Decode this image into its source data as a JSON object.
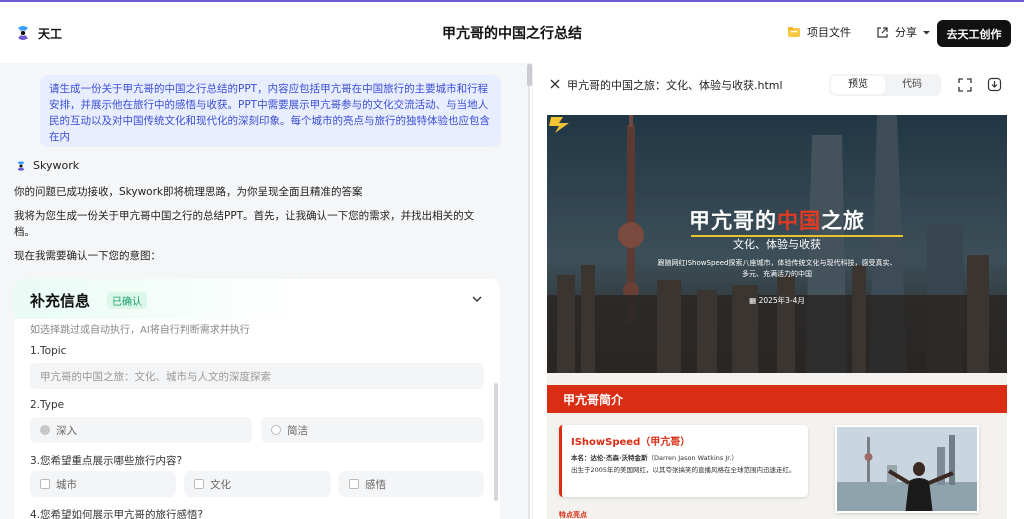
{
  "app": {
    "brand_name": "天工",
    "page_title": "甲亢哥的中国之行总结",
    "files_label": "项目文件",
    "share_label": "分享",
    "create_label": "去天工创作",
    "accent_color": "#3b4fd6"
  },
  "chat": {
    "user_prompt": "请生成一份关于甲亢哥的中国之行总结的PPT，内容应包括甲亢哥在中国旅行的主要城市和行程安排，并展示他在旅行中的感悟与收获。PPT中需要展示甲亢哥参与的文化交流活动、与当地人民的互动以及对中国传统文化和现代化的深刻印象。每个城市的亮点与旅行的独特体验也应包含在内",
    "agent_name": "Skywork",
    "reply_1": "你的问题已成功接收，Skywork即将梳理思路，为你呈现全面且精准的答案",
    "reply_2": "我将为您生成一份关于甲亢哥中国之行的总结PPT。首先，让我确认一下您的需求，并找出相关的文档。",
    "reply_3": "现在我需要确认一下您的意图：",
    "form": {
      "title": "补充信息",
      "badge": "已确认",
      "hint": "如选择跳过或自动执行，AI将自行判断需求并执行",
      "q1": "1.Topic",
      "topic_value": "甲亢哥的中国之旅：文化、城市与人文的深度探索",
      "q2": "2.Type",
      "type_options": [
        "深入",
        "简洁"
      ],
      "q3": "3.您希望重点展示哪些旅行内容?",
      "content_options": [
        "城市",
        "文化",
        "感悟"
      ],
      "q4": "4.您希望如何展示甲亢哥的旅行感悟?"
    }
  },
  "preview": {
    "file_name": "甲亢哥的中国之旅：文化、体验与收获.html",
    "tab_preview": "预览",
    "tab_code": "代码",
    "slide": {
      "title_part1": "甲亢哥的",
      "title_part2": "中国",
      "title_part3": "之旅",
      "subtitle": "文化、体验与收获",
      "desc": "跟随网红IShowSpeed探索八座城市，体验传统文化与现代科技，感受真实、多元、充满活力的中国",
      "date": "2025年3-4月",
      "section_title": "甲亢哥简介",
      "name": "IShowSpeed（甲亢哥）",
      "real_name_label": "本名：",
      "real_name": "达伦·杰森·沃特金斯",
      "real_name_en": "（Darren Jason Watkins Jr.）",
      "bio": "出生于2005年的美国网红，以其夸张搞笑的直播风格在全球范围内迅速走红。",
      "feature_label": "特点亮点",
      "accent_color": "#d92d14"
    }
  }
}
